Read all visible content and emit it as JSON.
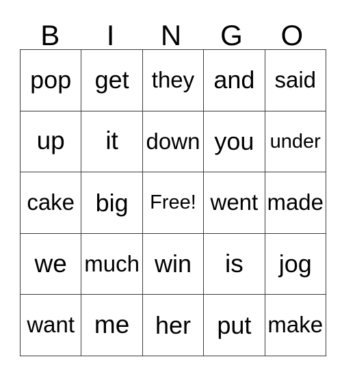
{
  "card": {
    "title": "BINGO",
    "headers": [
      "B",
      "I",
      "N",
      "G",
      "O"
    ],
    "free_space_label": "Free!",
    "rows": [
      [
        "pop",
        "get",
        "they",
        "and",
        "said"
      ],
      [
        "up",
        "it",
        "down",
        "you",
        "under"
      ],
      [
        "cake",
        "big",
        "Free!",
        "went",
        "made"
      ],
      [
        "we",
        "much",
        "win",
        "is",
        "jog"
      ],
      [
        "want",
        "me",
        "her",
        "put",
        "make"
      ]
    ],
    "colors": {
      "text": "#000000",
      "border": "#3a3a3a",
      "background": "#ffffff"
    }
  }
}
